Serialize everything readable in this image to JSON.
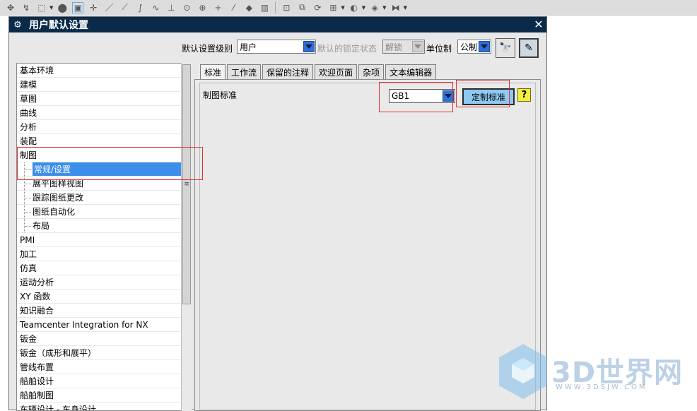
{
  "dialog": {
    "title": "用户默认设置",
    "level_label": "默认设置级别",
    "level_value": "用户",
    "lock_label": "默认的锁定状态",
    "lock_value": "解锁",
    "unit_label": "单位制",
    "unit_value": "公制"
  },
  "tree": {
    "items": [
      {
        "label": "基本环境"
      },
      {
        "label": "建模"
      },
      {
        "label": "草图"
      },
      {
        "label": "曲线"
      },
      {
        "label": "分析"
      },
      {
        "label": "装配"
      },
      {
        "label": "制图"
      },
      {
        "label": "常规/设置"
      },
      {
        "label": "展平图样视图"
      },
      {
        "label": "跟踪图纸更改"
      },
      {
        "label": "图纸自动化"
      },
      {
        "label": "布局"
      },
      {
        "label": "PMI"
      },
      {
        "label": "加工"
      },
      {
        "label": "仿真"
      },
      {
        "label": "运动分析"
      },
      {
        "label": "XY 函数"
      },
      {
        "label": "知识融合"
      },
      {
        "label": "Teamcenter Integration for NX"
      },
      {
        "label": "钣金"
      },
      {
        "label": "钣金（成形和展平）"
      },
      {
        "label": "管线布置"
      },
      {
        "label": "船舶设计"
      },
      {
        "label": "船舶制图"
      },
      {
        "label": "车辆设计 - 车身设计"
      }
    ]
  },
  "tabs": [
    {
      "label": "标准"
    },
    {
      "label": "工作流"
    },
    {
      "label": "保留的注释"
    },
    {
      "label": "欢迎页面"
    },
    {
      "label": "杂项"
    },
    {
      "label": "文本编辑器"
    }
  ],
  "panel": {
    "field_label": "制图标准",
    "standard_value": "GB1",
    "customize_button": "定制标准",
    "help_glyph": "?"
  },
  "watermark": {
    "text": "3D世界网",
    "url": "WWW.3DSJW.COM"
  }
}
